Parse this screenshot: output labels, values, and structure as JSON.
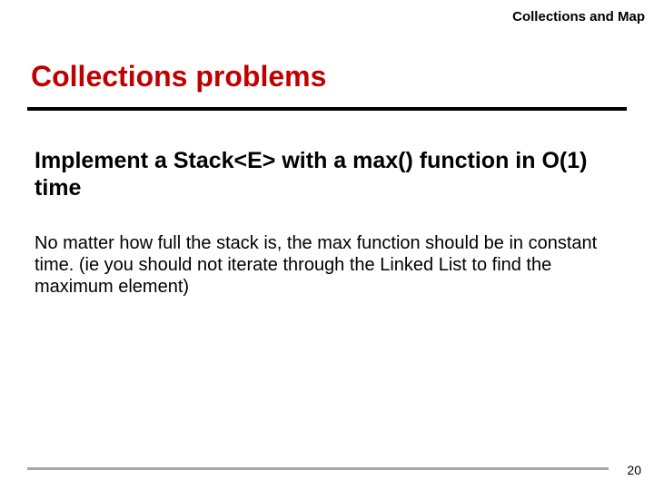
{
  "header": {
    "topic": "Collections and Map"
  },
  "title": "Collections problems",
  "subtitle": "Implement a Stack<E> with a max() function in O(1) time",
  "body": "No matter how full the stack is, the max function should be in constant time. (ie you should not iterate through the Linked List to find the maximum element)",
  "page_number": "20"
}
